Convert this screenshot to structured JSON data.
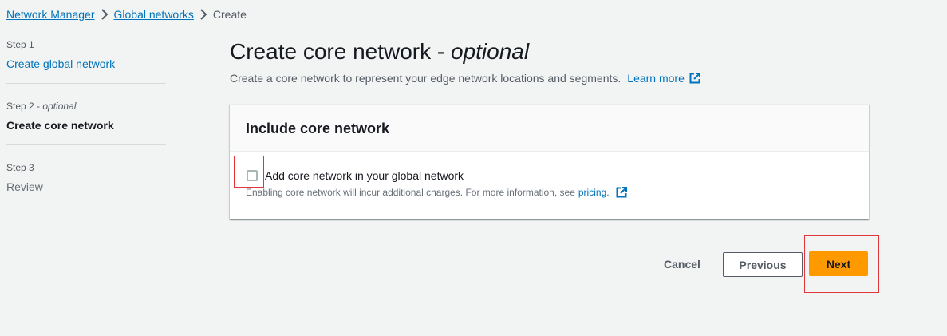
{
  "breadcrumb": {
    "items": [
      {
        "label": "Network Manager"
      },
      {
        "label": "Global networks"
      },
      {
        "label": "Create"
      }
    ]
  },
  "steps": [
    {
      "number": "Step 1",
      "optional": "",
      "label": "Create global network"
    },
    {
      "number": "Step 2 - ",
      "optional": "optional",
      "label": "Create core network"
    },
    {
      "number": "Step 3",
      "optional": "",
      "label": "Review"
    }
  ],
  "main": {
    "title": "Create core network - ",
    "title_optional": "optional",
    "description": "Create a core network to represent your edge network locations and segments.",
    "learn_more": "Learn more"
  },
  "card": {
    "title": "Include core network",
    "checkbox_label": "Add core network in your global network",
    "checkbox_checked": false,
    "hint": "Enabling core network will incur additional charges. For more information, see",
    "hint_link": "pricing."
  },
  "footer": {
    "cancel": "Cancel",
    "previous": "Previous",
    "next": "Next"
  },
  "colors": {
    "link": "#0073bb",
    "primary_button": "#ff9900",
    "highlight": "#e0363b"
  }
}
